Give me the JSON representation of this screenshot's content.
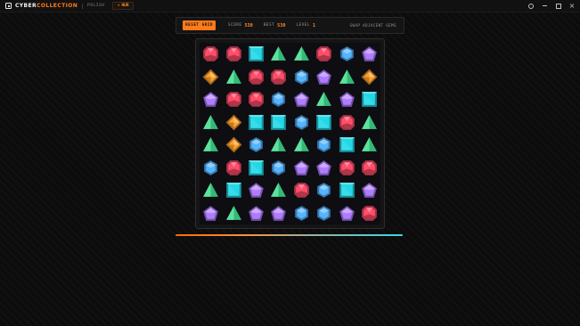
{
  "window": {
    "brand_primary": "CYBER",
    "brand_secondary": "COLLECTION",
    "section": "POLISH",
    "back_label": "HUB",
    "controls": [
      "gear-icon",
      "minimize-icon",
      "maximize-icon",
      "close-icon"
    ]
  },
  "hud": {
    "reset_label": "RESET GRID",
    "score_label": "SCORE",
    "score_value": "530",
    "best_label": "BEST",
    "best_value": "530",
    "level_label": "LEVEL",
    "level_value": "1",
    "hint": "SWAP ADJACENT GEMS"
  },
  "board": {
    "rows": 8,
    "cols": 8,
    "grid": [
      [
        "red",
        "red",
        "cyan",
        "green",
        "green",
        "red",
        "blue",
        "purple"
      ],
      [
        "orange",
        "green",
        "red",
        "red",
        "blue",
        "purple",
        "green",
        "orange"
      ],
      [
        "purple",
        "red",
        "red",
        "blue",
        "purple",
        "green",
        "purple",
        "cyan"
      ],
      [
        "green",
        "orange",
        "cyan",
        "cyan",
        "blue",
        "cyan",
        "red",
        "green"
      ],
      [
        "green",
        "orange",
        "blue",
        "green",
        "green",
        "blue",
        "cyan",
        "green"
      ],
      [
        "blue",
        "red",
        "cyan",
        "blue",
        "purple",
        "purple",
        "red",
        "red"
      ],
      [
        "green",
        "cyan",
        "purple",
        "green",
        "red",
        "blue",
        "cyan",
        "purple"
      ],
      [
        "purple",
        "green",
        "purple",
        "purple",
        "blue",
        "blue",
        "purple",
        "red"
      ]
    ]
  },
  "progress": {
    "fraction": 1.0
  },
  "colors": {
    "accent": "#ff7a1a",
    "red": "#ff4d6a",
    "cyan": "#22d8e6",
    "green": "#3fdc8c",
    "blue": "#55b4ff",
    "purple": "#b07cff",
    "orange": "#ffa12a"
  }
}
